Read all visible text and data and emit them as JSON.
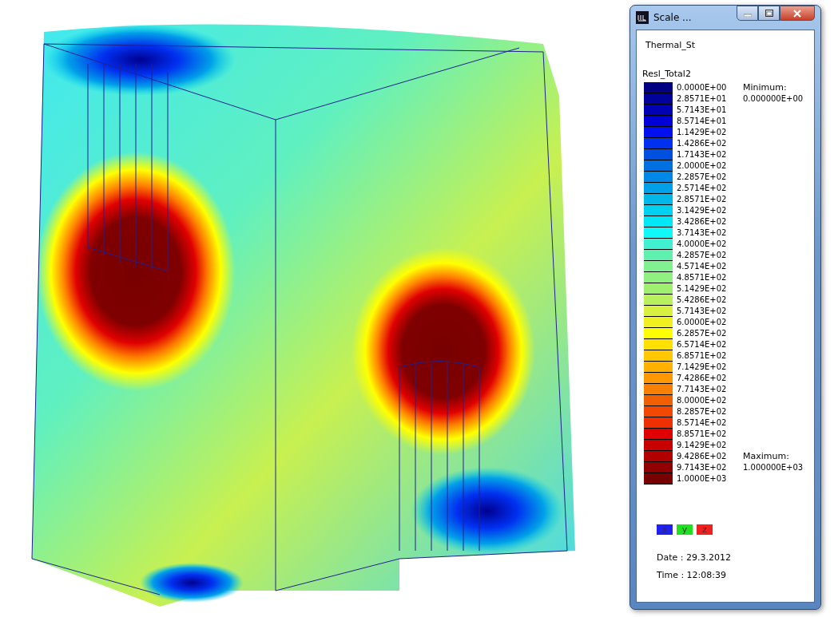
{
  "scale_window": {
    "title": "Scale ...",
    "analysis": "Thermal_St",
    "result": "Resl_Total2",
    "legend": [
      {
        "value": "0.0000E+00",
        "color": "#000080"
      },
      {
        "value": "2.8571E+01",
        "color": "#00009a"
      },
      {
        "value": "5.7143E+01",
        "color": "#0000b4"
      },
      {
        "value": "8.5714E+01",
        "color": "#0000d8"
      },
      {
        "value": "1.1429E+02",
        "color": "#0010f0"
      },
      {
        "value": "1.4286E+02",
        "color": "#0030f0"
      },
      {
        "value": "1.7143E+02",
        "color": "#0050e0"
      },
      {
        "value": "2.0000E+02",
        "color": "#0070e0"
      },
      {
        "value": "2.2857E+02",
        "color": "#0088e8"
      },
      {
        "value": "2.5714E+02",
        "color": "#00a0e8"
      },
      {
        "value": "2.8571E+02",
        "color": "#00b8e8"
      },
      {
        "value": "3.1429E+02",
        "color": "#00d0f0"
      },
      {
        "value": "3.4286E+02",
        "color": "#00e8f8"
      },
      {
        "value": "3.7143E+02",
        "color": "#10f8f8"
      },
      {
        "value": "4.0000E+02",
        "color": "#40f0d0"
      },
      {
        "value": "4.2857E+02",
        "color": "#60f0b0"
      },
      {
        "value": "4.5714E+02",
        "color": "#80f090"
      },
      {
        "value": "4.8571E+02",
        "color": "#90f080"
      },
      {
        "value": "5.1429E+02",
        "color": "#a0f070"
      },
      {
        "value": "5.4286E+02",
        "color": "#b8f060"
      },
      {
        "value": "5.7143E+02",
        "color": "#d8f040"
      },
      {
        "value": "6.0000E+02",
        "color": "#f0f020"
      },
      {
        "value": "6.2857E+02",
        "color": "#ffff00"
      },
      {
        "value": "6.5714E+02",
        "color": "#ffe000"
      },
      {
        "value": "6.8571E+02",
        "color": "#ffc800"
      },
      {
        "value": "7.1429E+02",
        "color": "#ffb000"
      },
      {
        "value": "7.4286E+02",
        "color": "#ff9800"
      },
      {
        "value": "7.7143E+02",
        "color": "#f88000"
      },
      {
        "value": "8.0000E+02",
        "color": "#f06000"
      },
      {
        "value": "8.2857E+02",
        "color": "#f04800"
      },
      {
        "value": "8.5714E+02",
        "color": "#f03000"
      },
      {
        "value": "8.8571E+02",
        "color": "#e00000"
      },
      {
        "value": "9.1429E+02",
        "color": "#c80000"
      },
      {
        "value": "9.4286E+02",
        "color": "#b00000"
      },
      {
        "value": "9.7143E+02",
        "color": "#900000"
      },
      {
        "value": "1.0000E+03",
        "color": "#780000"
      }
    ],
    "minimum": {
      "label": "Minimum:",
      "value": "0.000000E+00"
    },
    "maximum": {
      "label": "Maximum:",
      "value": "1.000000E+03"
    },
    "axes": [
      {
        "label": "x",
        "color": "#2020f0"
      },
      {
        "label": "y",
        "color": "#20e020"
      },
      {
        "label": "z",
        "color": "#f02020"
      }
    ],
    "date": "Date : 29.3.2012",
    "time": "Time : 12:08:39"
  }
}
